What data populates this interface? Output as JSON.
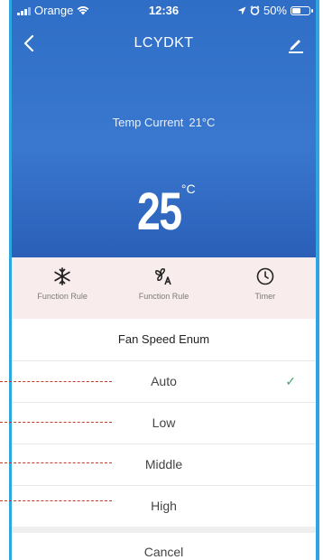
{
  "status_bar": {
    "carrier": "Orange",
    "time": "12:36",
    "battery_percent": "50%",
    "battery_level": 0.5
  },
  "nav": {
    "title": "LCYDKT",
    "back_icon": "chevron-left-icon",
    "edit_icon": "pencil-icon"
  },
  "hero": {
    "temp_current_label": "Temp Current",
    "temp_current_value": "21°C",
    "setpoint": "25",
    "setpoint_unit": "°C"
  },
  "functions": [
    {
      "label": "Function Rule",
      "icon": "snowflake-icon"
    },
    {
      "label": "Function Rule",
      "icon": "fan-auto-icon"
    },
    {
      "label": "Timer",
      "icon": "clock-icon"
    }
  ],
  "sheet": {
    "title": "Fan Speed Enum",
    "options": [
      {
        "label": "Auto",
        "selected": true
      },
      {
        "label": "Low",
        "selected": false
      },
      {
        "label": "Middle",
        "selected": false
      },
      {
        "label": "High",
        "selected": false
      }
    ],
    "check_mark": "✓",
    "cancel_label": "Cancel"
  },
  "colors": {
    "hero_blue": "#3a78cf",
    "function_bar_bg": "#f8ecec",
    "check_green": "#3fa86a",
    "frame_line": "#2ea7e0",
    "annotation_red": "#c0392b"
  }
}
